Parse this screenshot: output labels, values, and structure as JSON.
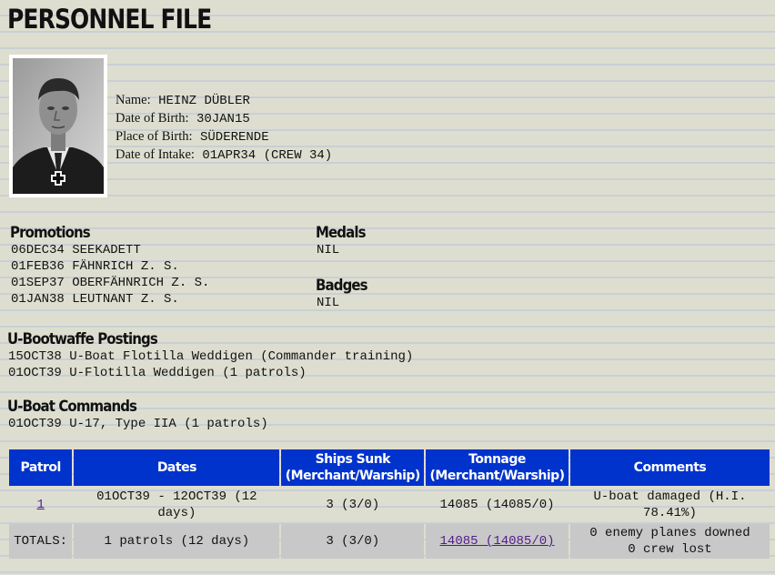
{
  "title": "PERSONNEL FILE",
  "person": {
    "name_label": "Name:",
    "name": "HEINZ DÜBLER",
    "dob_label": "Date of Birth:",
    "dob": "30JAN15",
    "pob_label": "Place of Birth:",
    "pob": "SÜDERENDE",
    "intake_label": "Date of Intake:",
    "intake": "01APR34 (CREW 34)"
  },
  "promotions": {
    "heading": "Promotions",
    "items": [
      "06DEC34 SEEKADETT",
      "01FEB36 FÄHNRICH Z. S.",
      "01SEP37 OBERFÄHNRICH Z. S.",
      "01JAN38 LEUTNANT Z. S."
    ]
  },
  "medals": {
    "heading": "Medals",
    "value": "NIL"
  },
  "badges": {
    "heading": "Badges",
    "value": "NIL"
  },
  "postings": {
    "heading": "U-Bootwaffe Postings",
    "items": [
      "15OCT38 U-Boat Flotilla Weddigen (Commander training)",
      "01OCT39 U-Flotilla Weddigen (1 patrols)"
    ]
  },
  "commands": {
    "heading": "U-Boat Commands",
    "items": [
      "01OCT39 U-17, Type IIA (1 patrols)"
    ]
  },
  "table": {
    "headers": {
      "patrol": "Patrol",
      "dates": "Dates",
      "ships_line1": "Ships Sunk",
      "ships_line2": "(Merchant/Warship)",
      "tonnage_line1": "Tonnage",
      "tonnage_line2": "(Merchant/Warship)",
      "comments": "Comments"
    },
    "rows": [
      {
        "patrol": "1",
        "dates": "01OCT39 - 12OCT39 (12 days)",
        "ships": "3 (3/0)",
        "tonnage": "14085 (14085/0)",
        "comments": "U-boat damaged (H.I. 78.41%)"
      }
    ],
    "totals": {
      "label": "TOTALS:",
      "patrols": "1 patrols (12 days)",
      "ships": "3 (3/0)",
      "tonnage": "14085 (14085/0)",
      "comments_line1": "0 enemy planes downed",
      "comments_line2": "0 crew lost"
    }
  },
  "colors": {
    "table_header": "#0033cc",
    "background": "#deded0",
    "link": "#551a8b"
  }
}
